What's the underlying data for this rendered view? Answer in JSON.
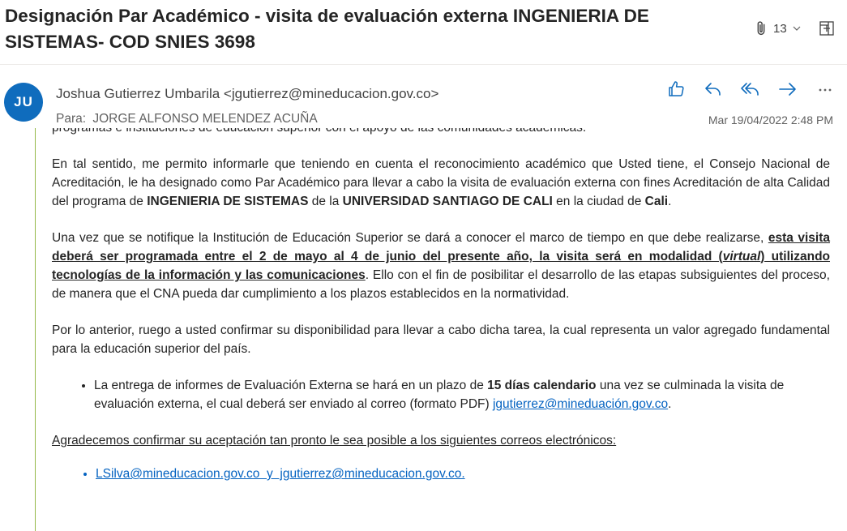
{
  "subject": "Designación Par Académico - visita de evaluación externa INGENIERIA DE SISTEMAS- COD SNIES 3698",
  "attachments": {
    "count": "13"
  },
  "sender": {
    "initials": "JU",
    "display": "Joshua Gutierrez Umbarila <jgutierrez@mineducacion.gov.co>",
    "to_label": "Para:",
    "to_name": "JORGE ALFONSO MELENDEZ ACUÑA",
    "date": "Mar 19/04/2022 2:48 PM"
  },
  "actions": {
    "like": "like-icon",
    "reply": "reply-icon",
    "reply_all": "reply-all-icon",
    "forward": "forward-icon",
    "more": "more-icon"
  },
  "body": {
    "p0": "programas e instituciones de educación superior con el apoyo de las comunidades académicas.",
    "p1_a": "En tal sentido, me permito informarle que teniendo en cuenta el reconocimiento académico que Usted tiene, el Consejo Nacional de Acreditación, le ha designado como Par Académico para llevar a cabo la visita de evaluación externa con fines Acreditación de alta Calidad del programa de ",
    "p1_program": "INGENIERIA DE SISTEMAS",
    "p1_b": " de la ",
    "p1_univ": "UNIVERSIDAD SANTIAGO DE CALI",
    "p1_c": " en la ciudad de ",
    "p1_city": "Cali",
    "p1_d": ".",
    "p2_a": "Una vez que se notifique la Institución de Educación Superior se dará a conocer el marco de tiempo en que debe realizarse, ",
    "p2_bold_u": "esta visita deberá ser programada entre el 2 de mayo al 4 de junio del presente año, la visita será en modalidad (",
    "p2_virtual": "virtual",
    "p2_bold_u2": ") utilizando tecnologías de la información y las comunicaciones",
    "p2_b": ". Ello con el fin de posibilitar el desarrollo de las etapas subsiguientes del proceso, de manera que el CNA pueda dar cumplimiento a los plazos establecidos en la normatividad.",
    "p3": "Por lo anterior, ruego a usted confirmar su disponibilidad para llevar a cabo dicha tarea, la cual representa un valor agregado fundamental para la educación superior del país.",
    "bullet_a": "La entrega de informes de Evaluación Externa se hará en un plazo de ",
    "bullet_bold": "15 días calendario",
    "bullet_b": " una vez se culminada la visita de evaluación externa, el cual deberá ser enviado al correo (formato PDF) ",
    "bullet_link": "jgutierrez@mineduación.gov.co",
    "bullet_c": ".",
    "confirm": "Agradecemos confirmar su aceptación tan pronto le sea posible a los siguientes correos electrónicos:",
    "emails_link": "LSilva@mineducacion.gov.co  y  jgutierrez@mineducacion.gov.co."
  },
  "colors": {
    "avatar_bg": "#0f6cbd",
    "accent_icon": "#0f6cbd",
    "link": "#0563c1",
    "quote_bar": "#96b94a"
  }
}
